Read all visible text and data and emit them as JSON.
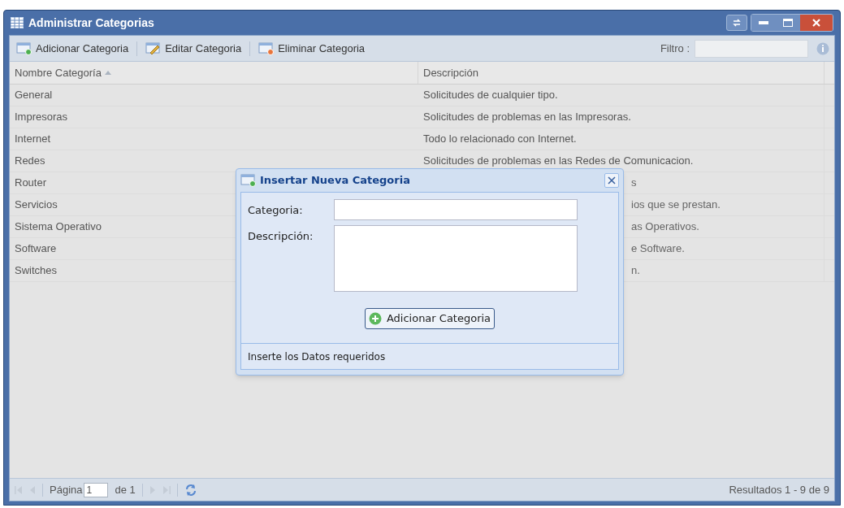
{
  "window": {
    "title": "Administrar Categorias"
  },
  "toolbar": {
    "buttons": [
      {
        "label": "Adicionar Categoria",
        "kind": "add"
      },
      {
        "label": "Editar Categoria",
        "kind": "edit"
      },
      {
        "label": "Eliminar Categoria",
        "kind": "delete"
      }
    ],
    "filter_label": "Filtro :"
  },
  "table": {
    "columns": [
      {
        "label": "Nombre Categoría",
        "sorted": true
      },
      {
        "label": "Descripción",
        "sorted": false
      }
    ],
    "rows": [
      {
        "name": "General",
        "description": "Solicitudes de cualquier tipo.",
        "partial": false
      },
      {
        "name": "Impresoras",
        "description": "Solicitudes de problemas en las Impresoras.",
        "partial": false
      },
      {
        "name": "Internet",
        "description": "Todo lo relacionado con Internet.",
        "partial": false
      },
      {
        "name": "Redes",
        "description": "Solicitudes de problemas en las Redes de Comunicacion.",
        "partial": false
      },
      {
        "name": "Router",
        "description": "s",
        "partial": true
      },
      {
        "name": "Servicios",
        "description": "ios que se prestan.",
        "partial": true
      },
      {
        "name": "Sistema Operativo",
        "description": "as Operativos.",
        "partial": true
      },
      {
        "name": "Software",
        "description": "e Software.",
        "partial": true
      },
      {
        "name": "Switches",
        "description": "n.",
        "partial": true
      }
    ]
  },
  "paging": {
    "page_label": "Página",
    "page": "1",
    "of": "de 1",
    "nav_disabled": true,
    "results": "Resultados 1 - 9 de 9"
  },
  "dialog": {
    "title": "Insertar Nueva Categoria",
    "fields": [
      {
        "label": "Categoria:",
        "kind": "text"
      },
      {
        "label": "Descripción:",
        "kind": "textarea"
      }
    ],
    "button": "Adicionar Categoria",
    "status": "Inserte los Datos requeridos"
  }
}
